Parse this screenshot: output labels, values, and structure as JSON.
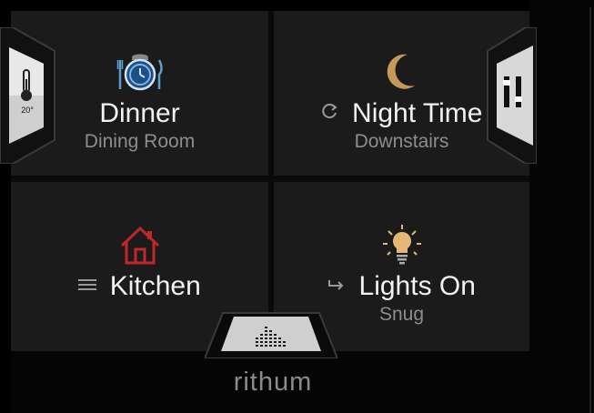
{
  "scenes": [
    {
      "title": "Dinner",
      "subtitle": "Dining Room",
      "icon": "dinner-plate-icon",
      "mode_icon": "",
      "icon_color": "#5a9fd4"
    },
    {
      "title": "Night Time",
      "subtitle": "Downstairs",
      "icon": "moon-icon",
      "mode_icon": "refresh-icon",
      "icon_color": "#c49a5a"
    },
    {
      "title": "Kitchen",
      "subtitle": "",
      "icon": "house-icon",
      "mode_icon": "menu-icon",
      "icon_color": "#c0262c"
    },
    {
      "title": "Lights On",
      "subtitle": "Snug",
      "icon": "lightbulb-icon",
      "mode_icon": "arrow-return-icon",
      "icon_color": "#e3b877"
    }
  ],
  "temperature": {
    "value": "20°",
    "icon": "thermometer-icon"
  },
  "mixer": {
    "icon": "sliders-icon"
  },
  "music": {
    "icon": "equalizer-icon"
  },
  "brand": {
    "logo": "rithum"
  }
}
